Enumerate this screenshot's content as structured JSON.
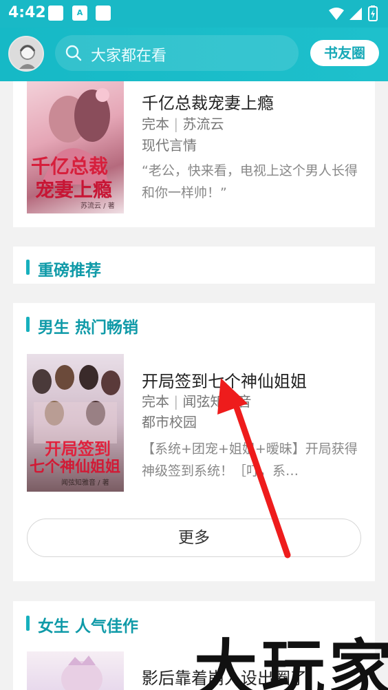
{
  "status_bar": {
    "time": "4:42",
    "icon_b": "A"
  },
  "header": {
    "search_placeholder": "大家都在看",
    "circle_button": "书友圈"
  },
  "top_book": {
    "title": "千亿总裁宠妻上瘾",
    "status": "完本",
    "author": "苏流云",
    "category": "现代言情",
    "desc": "“老公，快来看，电视上这个男人长得和你一样帅！”",
    "cover_title_line1": "千亿总裁",
    "cover_title_line2": "宠妻上瘾",
    "cover_author": "苏流云 / 著"
  },
  "sections": {
    "featured": {
      "title": "重磅推荐"
    },
    "male_hot": {
      "title": "男生 热门畅销",
      "book": {
        "title": "开局签到七个神仙姐姐",
        "status": "完本",
        "author": "闻弦知雅音",
        "category": "都市校园",
        "desc": "【系统+团宠+姐姐+暧昧】开局获得神级签到系统！［叮，系…",
        "cover_title_line1": "开局签到",
        "cover_title_line2": "七个神仙姐姐",
        "cover_author": "闻弦知雅音 / 著"
      },
      "more_label": "更多"
    },
    "female_pop": {
      "title": "女生 人气佳作",
      "book": {
        "title": "影后靠着崩人设出圈了"
      }
    }
  },
  "watermark": "大玩家",
  "colors": {
    "accent": "#19b9c6",
    "section_title": "#0f9aa8",
    "annotation_arrow": "#ee1c1c"
  }
}
